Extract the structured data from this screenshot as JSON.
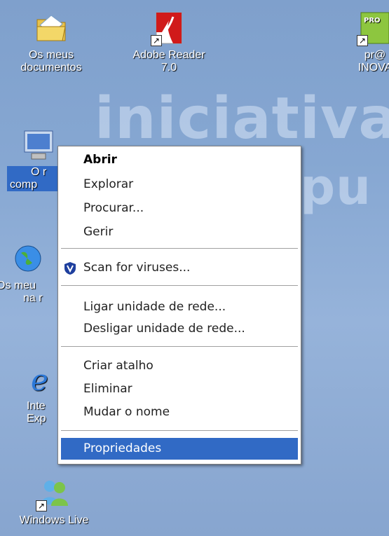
{
  "desktop": {
    "icons": [
      {
        "name": "os-meus-documentos",
        "line1": "Os meus",
        "line2": "documentos"
      },
      {
        "name": "adobe-reader",
        "line1": "Adobe Reader",
        "line2": "7.0"
      },
      {
        "name": "pr-inova",
        "line1": "pr@",
        "line2": "INOVA"
      },
      {
        "name": "o-meu-computador",
        "line1": "O r",
        "line2": "comp"
      },
      {
        "name": "os-meus-locais-na-rede",
        "line1": "Os meu",
        "line2": "na r"
      },
      {
        "name": "internet-explorer",
        "line1": "Inte",
        "line2": "Exp"
      },
      {
        "name": "windows-live",
        "line1": "Windows Live",
        "line2": ""
      }
    ]
  },
  "wallpaper": {
    "text1": "iniciativa",
    "text2": "pu"
  },
  "context_menu": {
    "items": [
      {
        "label": "Abrir"
      },
      {
        "label": "Explorar"
      },
      {
        "label": "Procurar..."
      },
      {
        "label": "Gerir"
      },
      {
        "label": "Scan for viruses..."
      },
      {
        "label": "Ligar unidade de rede..."
      },
      {
        "label": "Desligar unidade de rede..."
      },
      {
        "label": "Criar atalho"
      },
      {
        "label": "Eliminar"
      },
      {
        "label": "Mudar o nome"
      },
      {
        "label": "Propriedades"
      }
    ]
  },
  "colors": {
    "selection": "#316ac5",
    "desktop": "#86a7d2"
  }
}
